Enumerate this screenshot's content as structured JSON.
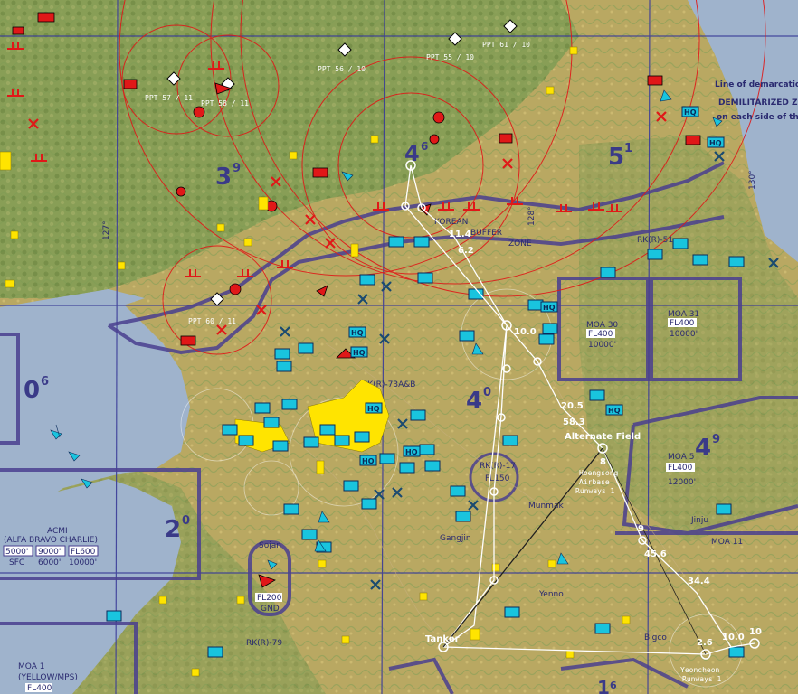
{
  "map": {
    "grid_labels": [
      {
        "big": "4",
        "small": "6"
      },
      {
        "big": "5",
        "small": "1"
      },
      {
        "big": "3",
        "small": "9"
      },
      {
        "big": "0",
        "small": "6"
      },
      {
        "big": "4",
        "small": "0"
      },
      {
        "big": "4",
        "small": "9"
      },
      {
        "big": "2",
        "small": "0"
      },
      {
        "big": "1",
        "small": "6"
      }
    ],
    "pre_planned_threats": [
      "PPT 61 / 10",
      "PPT 55 / 10",
      "PPT 56 / 10",
      "PPT 57 / 11",
      "PPT 58 / 11",
      "PPT 60 / 11"
    ],
    "chart_text": {
      "dmz_note_1": "Line of demarcatio",
      "dmz_note_2": "DEMILITARIZED ZON",
      "dmz_note_3": "on each side of th",
      "korean_buffer": "KOREAN",
      "buffer": "BUFFER",
      "zone": "ZONE",
      "rkr51": "RK(R)-51",
      "rkr73": "RK(R)-73A&B",
      "rkr79": "RK(R)-79",
      "rkr17": "RK(R)-17",
      "lon_127": "127°",
      "lon_128": "128°",
      "lon_130": "130°",
      "acmi_title": "ACMI",
      "acmi_sub": "(ALFA BRAVO CHARLIE)",
      "acmi_alts": [
        "5000'",
        "9000'",
        "FL600",
        "SFC",
        "6000'",
        "10000'"
      ],
      "moa30": "MOA 30",
      "moa30_fl": "FL400",
      "moa30_alt": "10000'",
      "moa31": "MOA 31",
      "moa31_fl": "FL400",
      "moa31_alt": "10000'",
      "moa5": "MOA 5",
      "moa5_fl": "FL400",
      "moa5_alt": "12000'",
      "moa11": "MOA 11",
      "moa1": "MOA 1",
      "moa1_sub": "(YELLOW/MPS)",
      "moa1_fl": "FL400",
      "fl200": "FL200",
      "gnd": "GND",
      "fl150": "FL150",
      "jinju": "Jinju",
      "munmak": "Munmak",
      "gangjin": "Gangjin",
      "yennoo": "Yenno",
      "bigco": "Bigco",
      "sojan": "Sojan",
      "hqs": "HQ"
    },
    "route": {
      "labels": {
        "s11_4": "11.4",
        "s6_2": "6.2",
        "s10_0": "10.0",
        "s20_5": "20.5",
        "s58_3": "58.3",
        "s45_6": "45.6",
        "s34_4": "34.4",
        "s10_0b": "10.0",
        "s2_6": "2.6",
        "s10": "10",
        "s9": "9",
        "s8": "8"
      },
      "alternate": "Alternate Field",
      "alt_sub_1": "Hoengsong",
      "alt_sub_2": "Airbase",
      "alt_sub_3": "Runways 1",
      "tanker": "Tanker",
      "dest_1": "Yeoncheon",
      "dest_2": "Runways 1"
    },
    "colors": {
      "ocean": "#9fb3cc",
      "land": "#c6b06c",
      "border": "#4a3f8f",
      "route": "#ffffff",
      "threat": "#e01818",
      "friendly": "#19c4de",
      "neutral": "#ffe400"
    }
  }
}
